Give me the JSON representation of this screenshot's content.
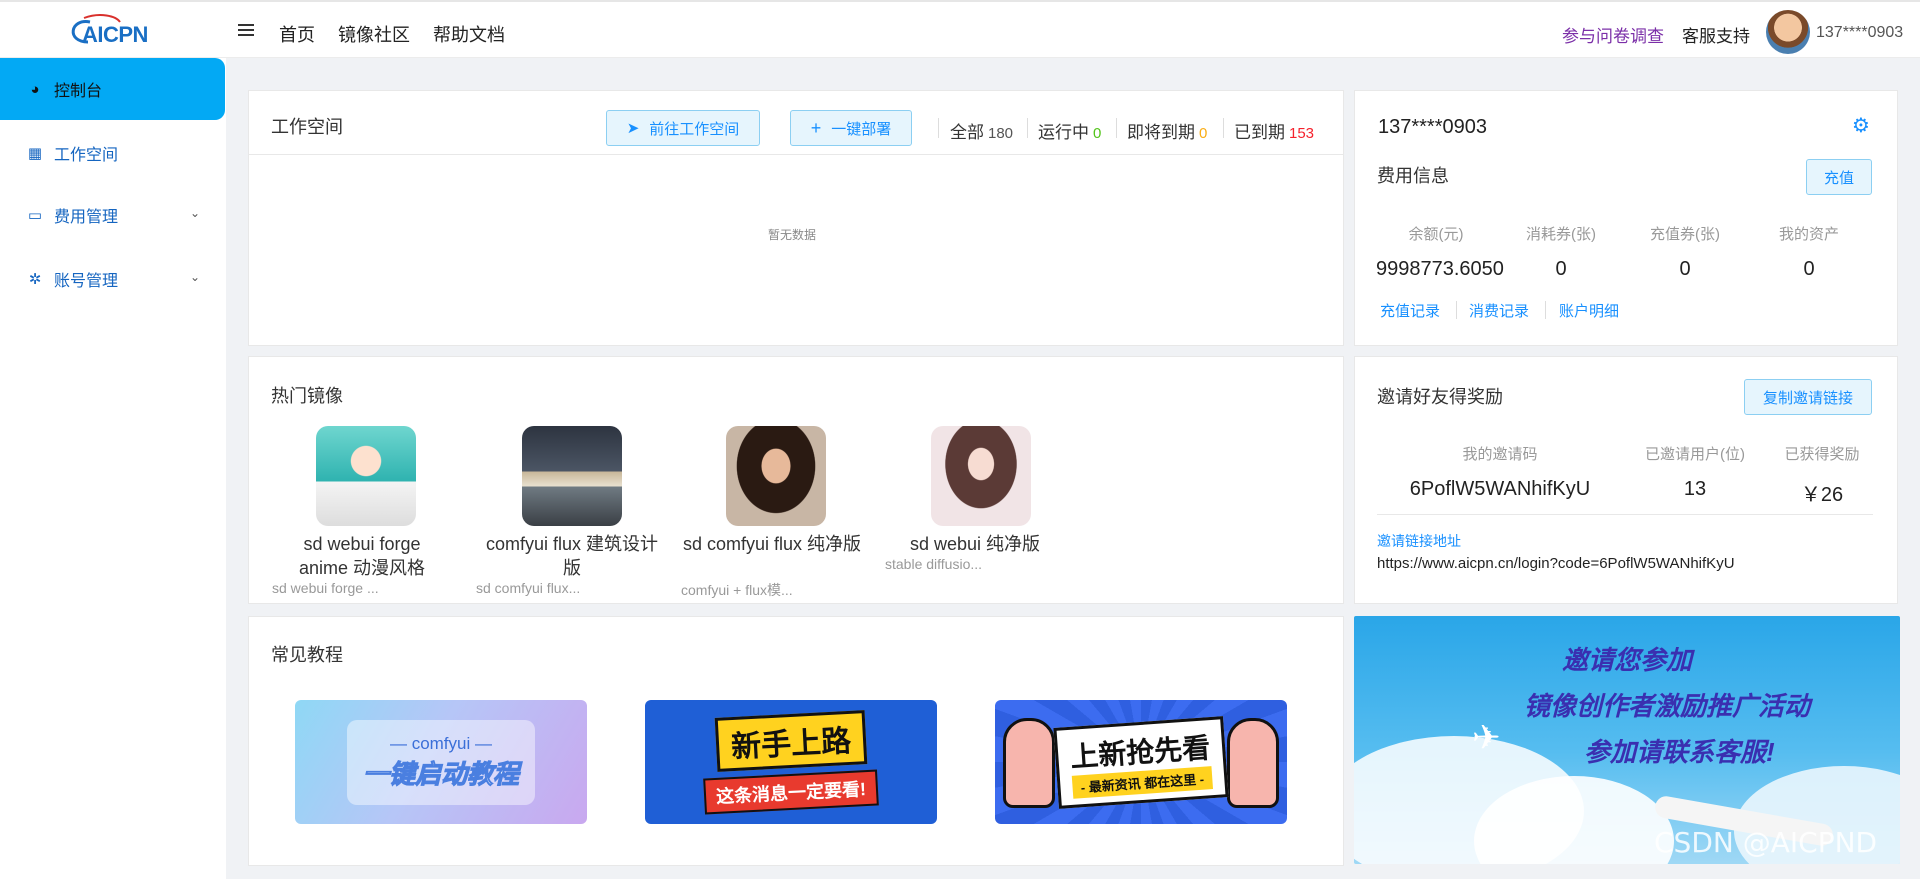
{
  "header": {
    "logo_text": "AICPN",
    "nav": [
      "首页",
      "镜像社区",
      "帮助文档"
    ],
    "survey": "参与问卷调查",
    "support": "客服支持",
    "username": "137****0903"
  },
  "sidebar": {
    "items": [
      {
        "label": "控制台",
        "active": true
      },
      {
        "label": "工作空间"
      },
      {
        "label": "费用管理"
      },
      {
        "label": "账号管理"
      }
    ]
  },
  "workspace": {
    "title": "工作空间",
    "goto_button": "前往工作空间",
    "deploy_button": "一键部署",
    "stats": [
      {
        "label": "全部",
        "value": "180",
        "color": "#555555"
      },
      {
        "label": "运行中",
        "value": "0",
        "color": "#52c41a"
      },
      {
        "label": "即将到期",
        "value": "0",
        "color": "#faad14"
      },
      {
        "label": "已到期",
        "value": "153",
        "color": "#f5222d"
      }
    ],
    "empty_text": "暂无数据"
  },
  "hot_images": {
    "title": "热门镜像",
    "items": [
      {
        "name": "sd webui forge anime 动漫风格",
        "desc": "sd webui forge ..."
      },
      {
        "name": "comfyui flux 建筑设计版",
        "desc": "sd comfyui flux..."
      },
      {
        "name": "sd comfyui flux 纯净版",
        "desc": "comfyui + flux模..."
      },
      {
        "name": "sd webui 纯净版",
        "desc": "stable diffusio..."
      }
    ]
  },
  "tutorials": {
    "title": "常见教程",
    "banners": [
      {
        "top": "— comfyui —",
        "main": "一键启动教程"
      },
      {
        "top": "新手上路",
        "main": "这条消息一定要看!"
      },
      {
        "top": "上新抢先看",
        "main": "- 最新资讯 都在这里 -"
      }
    ]
  },
  "account": {
    "phone": "137****0903",
    "fee_title": "费用信息",
    "recharge_button": "充值",
    "columns": [
      "余额(元)",
      "消耗券(张)",
      "充值券(张)",
      "我的资产"
    ],
    "values": [
      "9998773.6050",
      "0",
      "0",
      "0"
    ],
    "links": [
      "充值记录",
      "消费记录",
      "账户明细"
    ]
  },
  "invite": {
    "title": "邀请好友得奖励",
    "copy_button": "复制邀请链接",
    "columns": [
      "我的邀请码",
      "已邀请用户(位)",
      "已获得奖励"
    ],
    "values": [
      "6PoflW5WANhifKyU",
      "13",
      "￥26"
    ],
    "link_label": "邀请链接地址",
    "link_url": "https://www.aicpn.cn/login?code=6PoflW5WANhifKyU"
  },
  "promo": {
    "line1": "邀请您参加",
    "line2": "镜像创作者激励推广活动",
    "line3": "参加请联系客服!",
    "watermark": "CSDN @AICPND"
  }
}
